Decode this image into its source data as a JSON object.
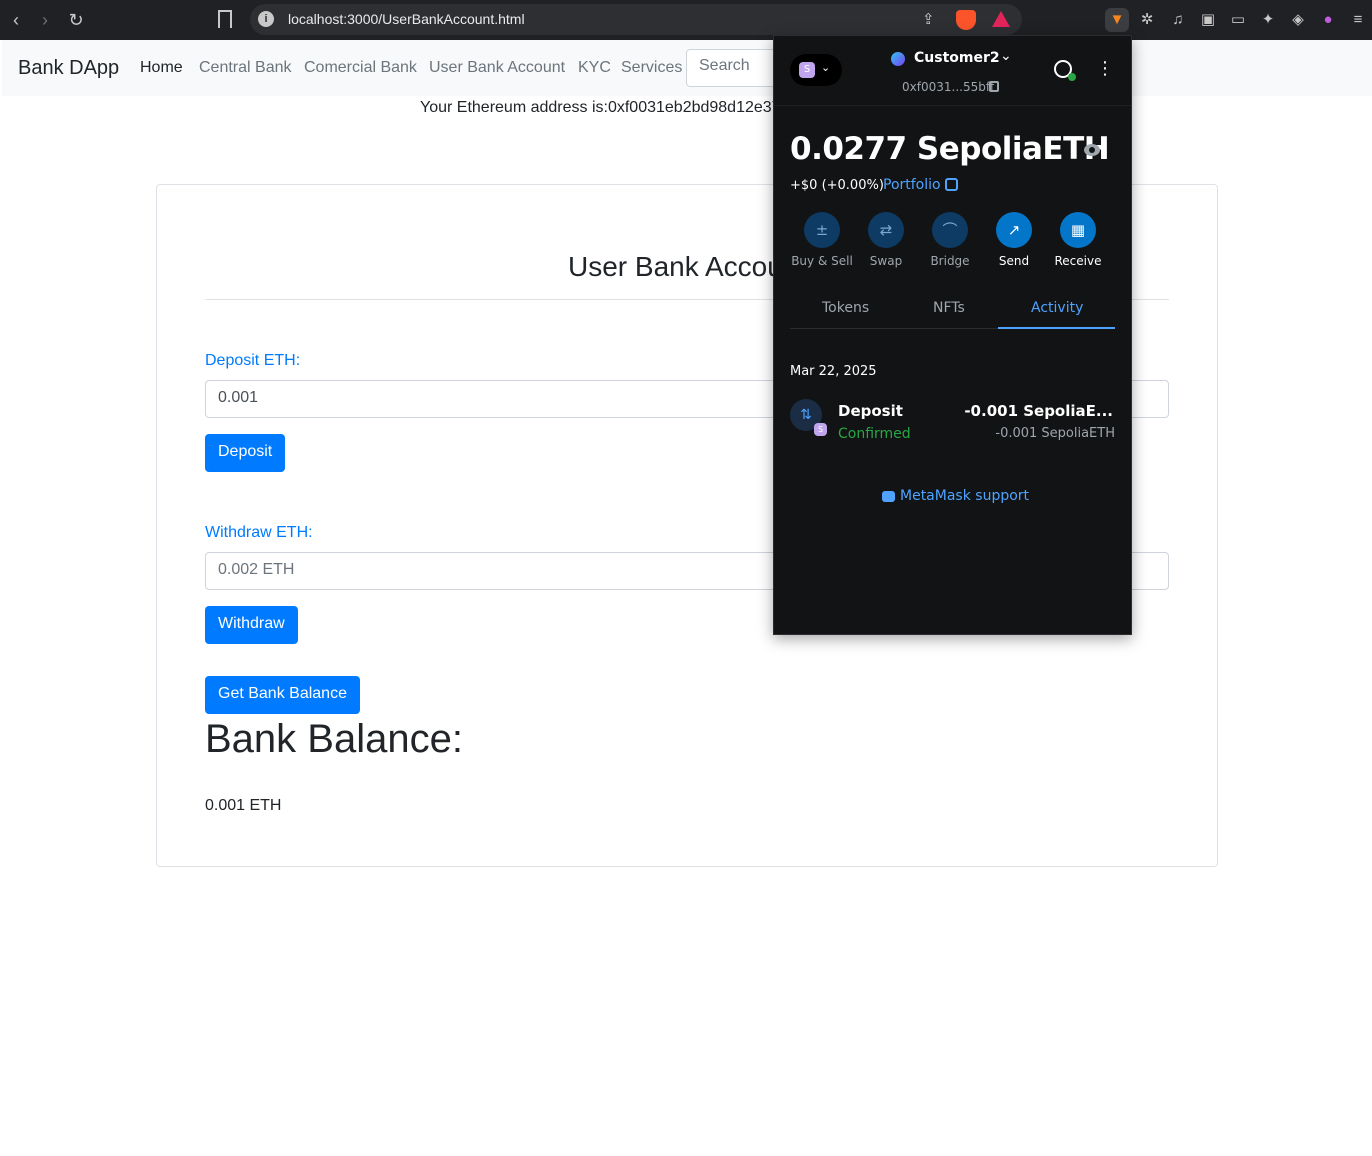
{
  "browser": {
    "url": "localhost:3000/UserBankAccount.html",
    "info_icon": "i",
    "back_icon": "‹",
    "forward_icon": "›",
    "reload_icon": "↻"
  },
  "navbar": {
    "brand": "Bank DApp",
    "links": [
      "Home",
      "Central Bank",
      "Comercial Bank",
      "User Bank Account",
      "KYC",
      "Services"
    ],
    "search_placeholder": "Search"
  },
  "address_line": "Your Ethereum address is:0xf0031eb2bd98d12e37",
  "card": {
    "title": "User Bank Account",
    "deposit_label": "Deposit ETH:",
    "deposit_value": "0.001",
    "deposit_button": "Deposit",
    "withdraw_label": "Withdraw ETH:",
    "withdraw_placeholder": "0.002 ETH",
    "withdraw_button": "Withdraw",
    "balance_button": "Get Bank Balance",
    "balance_heading": "Bank Balance:",
    "balance_value": "0.001 ETH"
  },
  "metamask": {
    "network_letter": "S",
    "account_name": "Customer2",
    "account_address": "0xf0031...55bff",
    "balance": "0.0277 SepoliaETH",
    "change": "+$0 (+0.00%)",
    "portfolio": "Portfolio",
    "kebab": "⋮",
    "actions": [
      "Buy & Sell",
      "Swap",
      "Bridge",
      "Send",
      "Receive"
    ],
    "tabs": [
      "Tokens",
      "NFTs",
      "Activity"
    ],
    "activity": {
      "date": "Mar 22, 2025",
      "tx": {
        "title": "Deposit",
        "status": "Confirmed",
        "amount": "-0.001 SepoliaE...",
        "amount_sub": "-0.001 SepoliaETH",
        "badge": "S"
      }
    },
    "support": "MetaMask support"
  },
  "colors": {
    "primary": "#007bff",
    "metamask_bg": "#121314",
    "metamask_link": "#4fa3ff",
    "confirmed": "#28a745"
  }
}
